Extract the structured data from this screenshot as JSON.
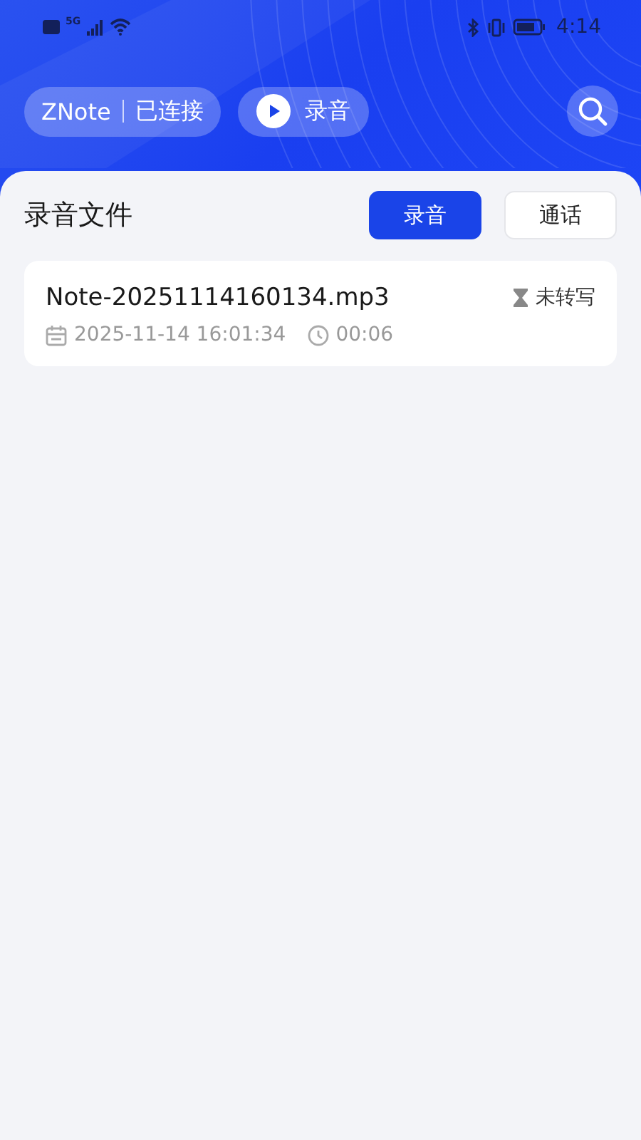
{
  "status_bar": {
    "network": "5G",
    "time": "4:14"
  },
  "header": {
    "device": "ZNote",
    "connection": "已连接",
    "record_button": "录音"
  },
  "section": {
    "title": "录音文件"
  },
  "tabs": [
    {
      "label": "录音",
      "selected": true
    },
    {
      "label": "通话",
      "selected": false
    }
  ],
  "files": [
    {
      "name": "Note-20251114160134.mp3",
      "date": "2025-11-14 16:01:34",
      "duration": "00:06",
      "status": "未转写"
    }
  ]
}
